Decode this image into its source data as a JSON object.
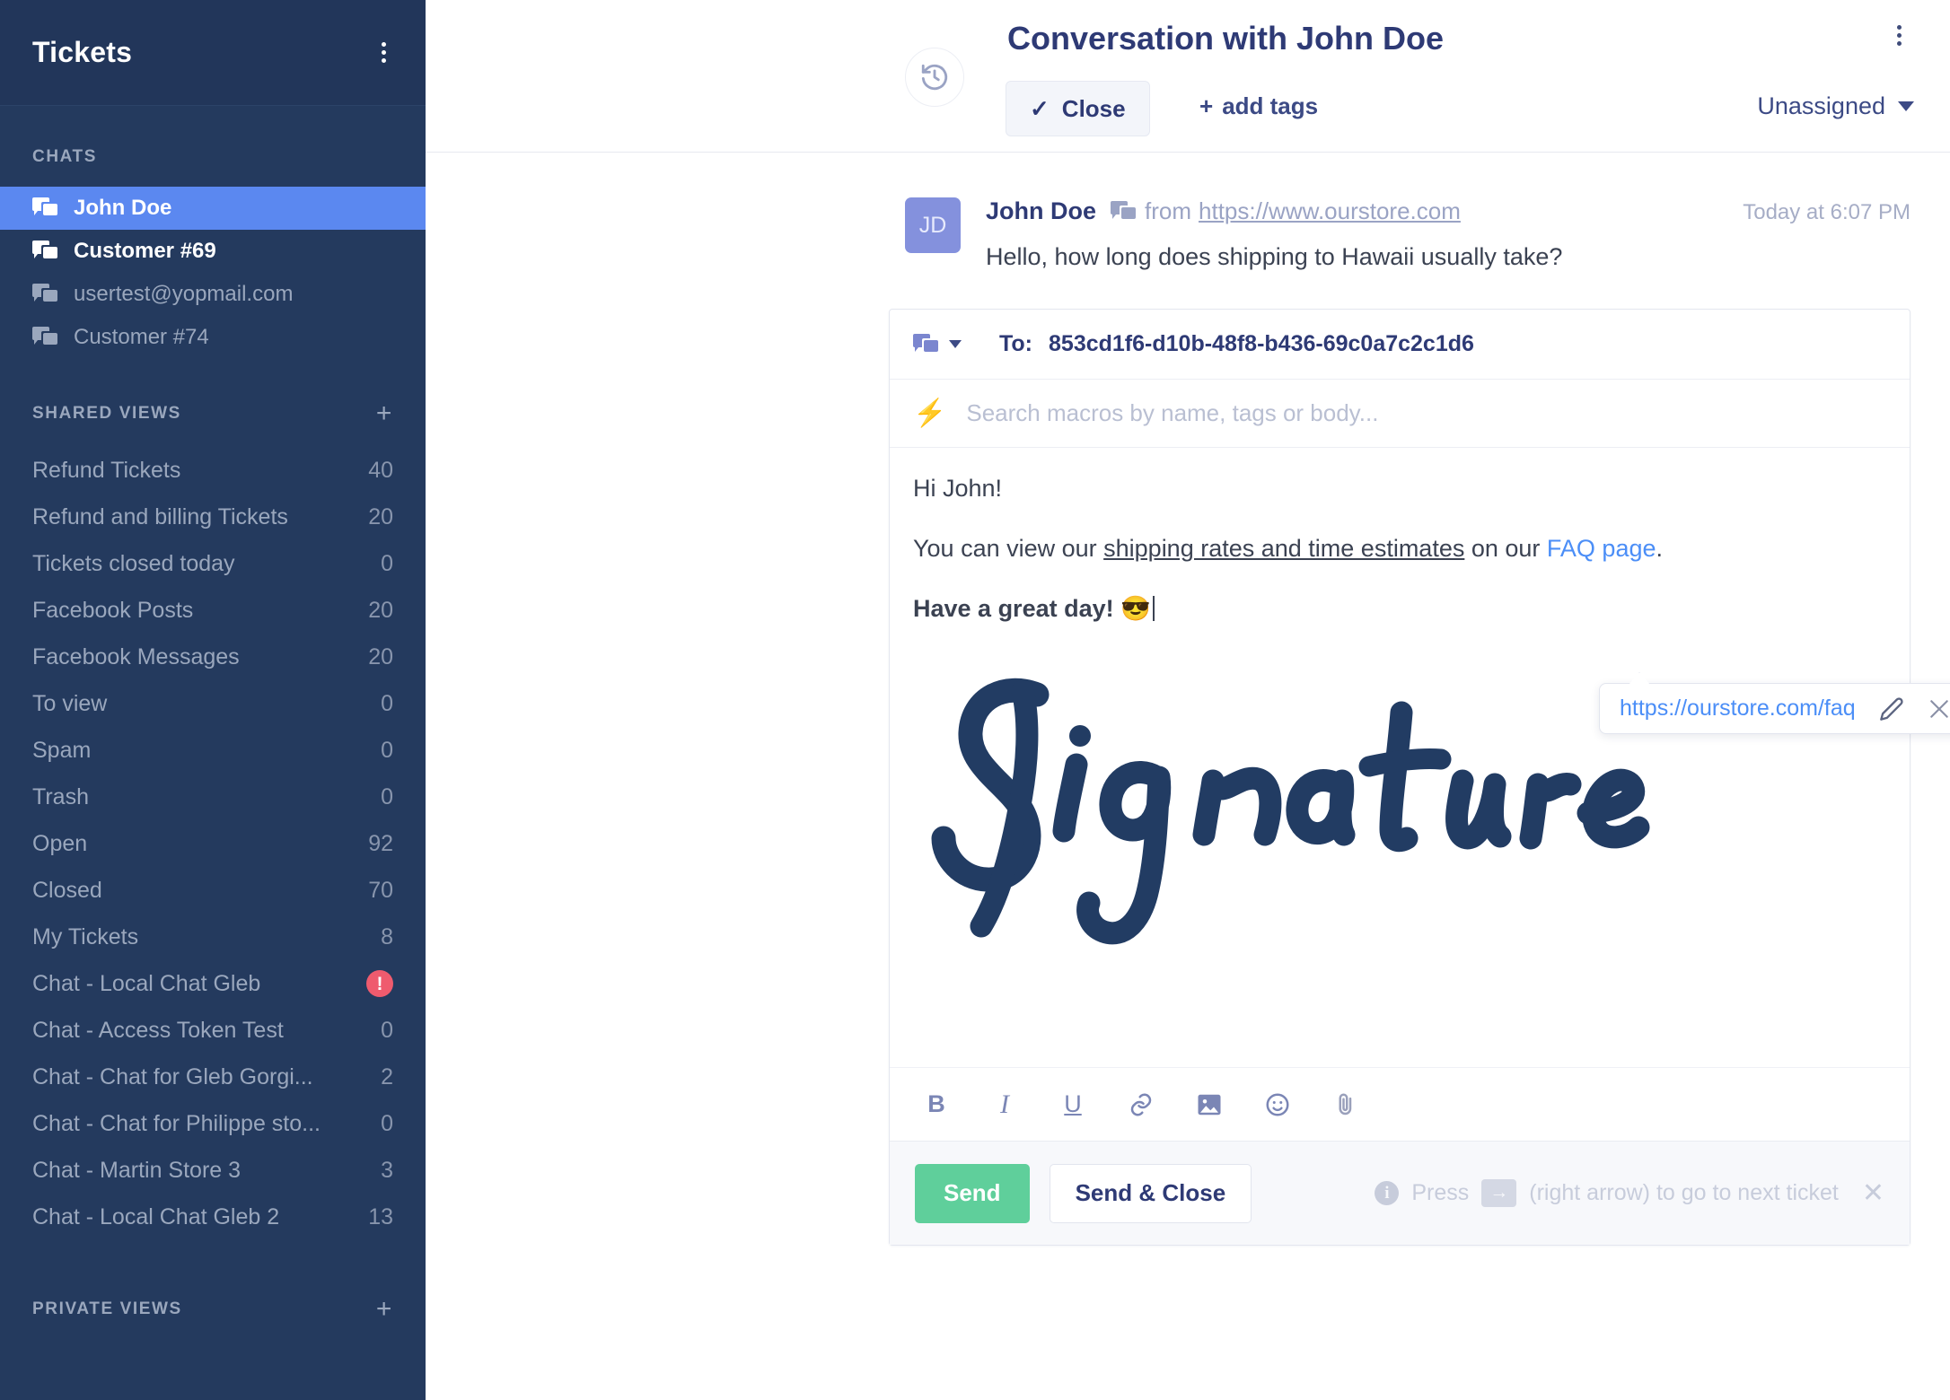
{
  "sidebar": {
    "title": "Tickets",
    "chats_label": "CHATS",
    "chats": [
      {
        "label": "John Doe",
        "state": "selected"
      },
      {
        "label": "Customer #69",
        "state": "unread"
      },
      {
        "label": "usertest@yopmail.com",
        "state": "read"
      },
      {
        "label": "Customer #74",
        "state": "read"
      }
    ],
    "shared_views_label": "SHARED VIEWS",
    "shared_views_add": "+",
    "shared_views": [
      {
        "label": "Refund Tickets",
        "count": "40"
      },
      {
        "label": "Refund and billing Tickets",
        "count": "20"
      },
      {
        "label": "Tickets closed today",
        "count": "0"
      },
      {
        "label": "Facebook Posts",
        "count": "20"
      },
      {
        "label": "Facebook Messages",
        "count": "20"
      },
      {
        "label": "To view",
        "count": "0"
      },
      {
        "label": "Spam",
        "count": "0"
      },
      {
        "label": "Trash",
        "count": "0"
      },
      {
        "label": "Open",
        "count": "92"
      },
      {
        "label": "Closed",
        "count": "70"
      },
      {
        "label": "My Tickets",
        "count": "8"
      },
      {
        "label": "Chat - Local Chat Gleb",
        "count": "!",
        "badge": "alert"
      },
      {
        "label": "Chat - Access Token Test",
        "count": "0"
      },
      {
        "label": "Chat - Chat for Gleb Gorgi...",
        "count": "2"
      },
      {
        "label": "Chat - Chat for Philippe sto...",
        "count": "0"
      },
      {
        "label": "Chat - Martin Store 3",
        "count": "3"
      },
      {
        "label": "Chat - Local Chat Gleb 2",
        "count": "13"
      }
    ],
    "private_views_label": "PRIVATE VIEWS",
    "private_views_add": "+"
  },
  "header": {
    "title": "Conversation with John Doe",
    "close_label": "Close",
    "close_check": "✓",
    "add_tags_plus": "+",
    "add_tags_label": "add tags",
    "assignee_label": "Unassigned"
  },
  "message": {
    "avatar_initials": "JD",
    "author": "John Doe",
    "from_label": "from",
    "from_url": "https://www.ourstore.com",
    "timestamp": "Today at 6:07 PM",
    "text": "Hello, how long does shipping to Hawaii usually take?"
  },
  "composer": {
    "to_label": "To:",
    "to_value": "853cd1f6-d10b-48f8-b436-69c0a7c2c1d6",
    "macro_placeholder": "Search macros by name, tags or body...",
    "body": {
      "line1": "Hi John!",
      "line2_pre": "You can view our ",
      "line2_underlined": "shipping rates and time estimates",
      "line2_mid": " on our ",
      "line2_link": "FAQ page",
      "line2_post": ".",
      "line3": "Have a great day! 😎"
    },
    "link_popup": {
      "url": "https://ourstore.com/faq",
      "edit_icon": "pencil-icon",
      "remove_icon": "close-icon"
    },
    "signature_alt": "Signature",
    "toolbar": [
      {
        "name": "bold",
        "label": "B"
      },
      {
        "name": "italic",
        "label": "I"
      },
      {
        "name": "underline",
        "label": "U"
      },
      {
        "name": "link",
        "label": "🔗"
      },
      {
        "name": "image",
        "label": "▣"
      },
      {
        "name": "emoji",
        "label": "☺"
      },
      {
        "name": "attachment",
        "label": "📎"
      }
    ],
    "send_label": "Send",
    "send_close_label": "Send & Close",
    "hint_pre": "Press",
    "hint_key": "→",
    "hint_post": "(right arrow) to go to next ticket",
    "hint_close": "✕"
  },
  "colors": {
    "sidebar_bg": "#243a5e",
    "sidebar_selected": "#5b88f0",
    "accent_title": "#2e3a75",
    "send_green": "#5fcf9b",
    "link_blue": "#4b8ef7",
    "alert_red": "#ef5b6e",
    "avatar_purple": "#8491dd",
    "signature_navy": "#223c63"
  }
}
